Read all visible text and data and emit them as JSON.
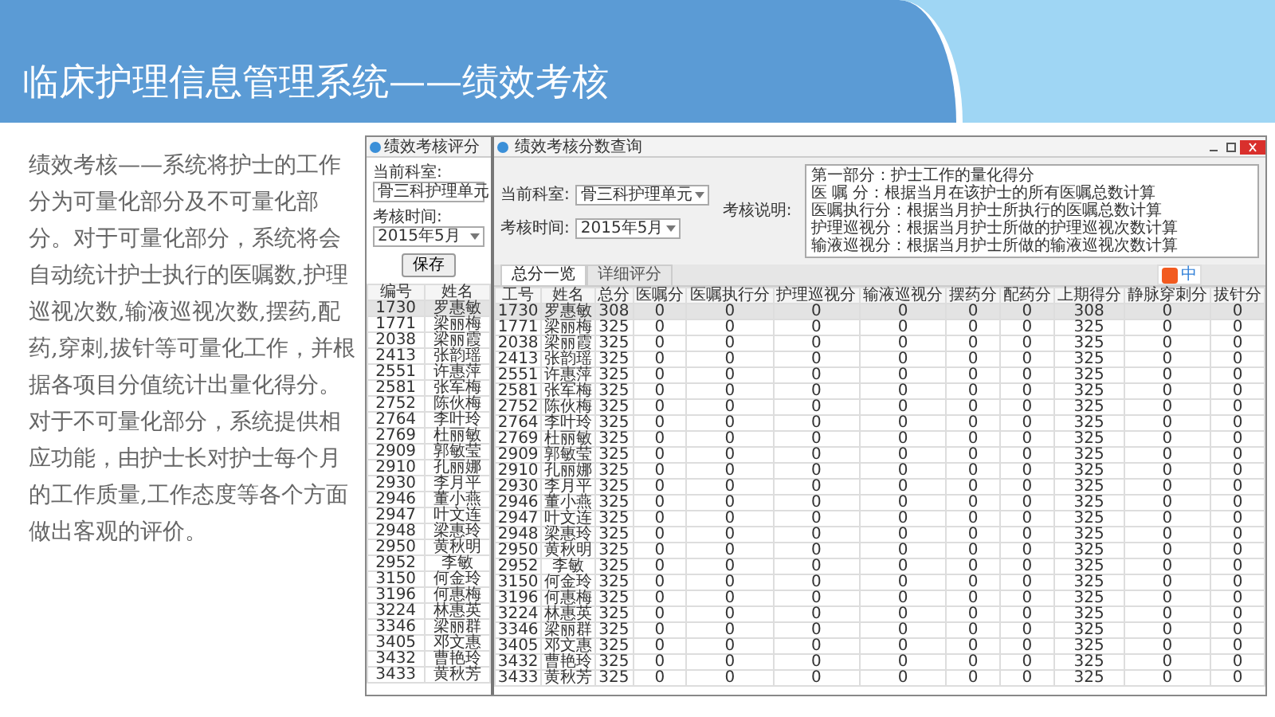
{
  "slide": {
    "title": "临床护理信息管理系统——绩效考核"
  },
  "description": "绩效考核——系统将护士的工作分为可量化部分及不可量化部分。对于可量化部分，系统将会自动统计护士执行的医嘱数,护理巡视次数,输液巡视次数,摆药,配药,穿刺,拔针等可量化工作，并根据各项目分值统计出量化得分。对于不可量化部分，系统提供相应功能，由护士长对护士每个月的工作质量,工作态度等各个方面做出客观的评价。",
  "score_window": {
    "title": "绩效考核评分",
    "fields": [
      {
        "label": "当前科室:",
        "value": "骨三科护理单元"
      },
      {
        "label": "考核时间:",
        "value": "2015年5月"
      }
    ],
    "save_button": "保存",
    "columns": [
      "编号",
      "姓名"
    ],
    "rows": [
      {
        "cells": [
          "1730",
          "罗惠敏"
        ],
        "selected": true
      },
      {
        "cells": [
          "1771",
          "梁丽梅"
        ],
        "selected": false
      },
      {
        "cells": [
          "2038",
          "梁丽霞"
        ],
        "selected": false
      },
      {
        "cells": [
          "2413",
          "张韵瑶"
        ],
        "selected": false
      },
      {
        "cells": [
          "2551",
          "许惠萍"
        ],
        "selected": false
      },
      {
        "cells": [
          "2581",
          "张军梅"
        ],
        "selected": false
      },
      {
        "cells": [
          "2752",
          "陈伙梅"
        ],
        "selected": false
      },
      {
        "cells": [
          "2764",
          "李叶玲"
        ],
        "selected": false
      },
      {
        "cells": [
          "2769",
          "杜丽敏"
        ],
        "selected": false
      },
      {
        "cells": [
          "2909",
          "郭敏莹"
        ],
        "selected": false
      },
      {
        "cells": [
          "2910",
          "孔丽娜"
        ],
        "selected": false
      },
      {
        "cells": [
          "2930",
          "李月平"
        ],
        "selected": false
      },
      {
        "cells": [
          "2946",
          "董小燕"
        ],
        "selected": false
      },
      {
        "cells": [
          "2947",
          "叶文连"
        ],
        "selected": false
      },
      {
        "cells": [
          "2948",
          "梁惠玲"
        ],
        "selected": false
      },
      {
        "cells": [
          "2950",
          "黄秋明"
        ],
        "selected": false
      },
      {
        "cells": [
          "2952",
          "李敏"
        ],
        "selected": false
      },
      {
        "cells": [
          "3150",
          "何金玲"
        ],
        "selected": false
      },
      {
        "cells": [
          "3196",
          "何惠梅"
        ],
        "selected": false
      },
      {
        "cells": [
          "3224",
          "林惠英"
        ],
        "selected": false
      },
      {
        "cells": [
          "3346",
          "梁丽群"
        ],
        "selected": false
      },
      {
        "cells": [
          "3405",
          "邓文惠"
        ],
        "selected": false
      },
      {
        "cells": [
          "3432",
          "曹艳玲"
        ],
        "selected": false
      },
      {
        "cells": [
          "3433",
          "黄秋芳"
        ],
        "selected": false
      }
    ]
  },
  "query_window": {
    "title": "绩效考核分数查询",
    "fields": [
      {
        "label": "当前科室:",
        "value": "骨三科护理单元"
      },
      {
        "label": "考核时间:",
        "value": "2015年5月"
      }
    ],
    "notes_label": "考核说明:",
    "notes": [
      "第一部分：护士工作的量化得分",
      "医 嘱 分：根据当月在该护士的所有医嘱总数计算",
      "医嘱执行分：根据当月护士所执行的医嘱总数计算",
      "护理巡视分：根据当月护士所做的护理巡视次数计算",
      "输液巡视分：根据当月护士所做的输液巡视次数计算"
    ],
    "tabs": [
      {
        "label": "总分一览",
        "selected": true
      },
      {
        "label": "详细评分",
        "selected": false
      }
    ],
    "columns": [
      "工号",
      "姓名",
      "总分",
      "医嘱分",
      "医嘱执行分",
      "护理巡视分",
      "输液巡视分",
      "摆药分",
      "配药分",
      "上期得分",
      "静脉穿刺分",
      "拔针分"
    ],
    "rows": [
      {
        "cells": [
          "1730",
          "罗惠敏",
          "308",
          "0",
          "0",
          "0",
          "0",
          "0",
          "0",
          "308",
          "0",
          "0"
        ],
        "selected": true
      },
      {
        "cells": [
          "1771",
          "梁丽梅",
          "325",
          "0",
          "0",
          "0",
          "0",
          "0",
          "0",
          "325",
          "0",
          "0"
        ],
        "selected": false
      },
      {
        "cells": [
          "2038",
          "梁丽霞",
          "325",
          "0",
          "0",
          "0",
          "0",
          "0",
          "0",
          "325",
          "0",
          "0"
        ],
        "selected": false
      },
      {
        "cells": [
          "2413",
          "张韵瑶",
          "325",
          "0",
          "0",
          "0",
          "0",
          "0",
          "0",
          "325",
          "0",
          "0"
        ],
        "selected": false
      },
      {
        "cells": [
          "2551",
          "许惠萍",
          "325",
          "0",
          "0",
          "0",
          "0",
          "0",
          "0",
          "325",
          "0",
          "0"
        ],
        "selected": false
      },
      {
        "cells": [
          "2581",
          "张军梅",
          "325",
          "0",
          "0",
          "0",
          "0",
          "0",
          "0",
          "325",
          "0",
          "0"
        ],
        "selected": false
      },
      {
        "cells": [
          "2752",
          "陈伙梅",
          "325",
          "0",
          "0",
          "0",
          "0",
          "0",
          "0",
          "325",
          "0",
          "0"
        ],
        "selected": false
      },
      {
        "cells": [
          "2764",
          "李叶玲",
          "325",
          "0",
          "0",
          "0",
          "0",
          "0",
          "0",
          "325",
          "0",
          "0"
        ],
        "selected": false
      },
      {
        "cells": [
          "2769",
          "杜丽敏",
          "325",
          "0",
          "0",
          "0",
          "0",
          "0",
          "0",
          "325",
          "0",
          "0"
        ],
        "selected": false
      },
      {
        "cells": [
          "2909",
          "郭敏莹",
          "325",
          "0",
          "0",
          "0",
          "0",
          "0",
          "0",
          "325",
          "0",
          "0"
        ],
        "selected": false
      },
      {
        "cells": [
          "2910",
          "孔丽娜",
          "325",
          "0",
          "0",
          "0",
          "0",
          "0",
          "0",
          "325",
          "0",
          "0"
        ],
        "selected": false
      },
      {
        "cells": [
          "2930",
          "李月平",
          "325",
          "0",
          "0",
          "0",
          "0",
          "0",
          "0",
          "325",
          "0",
          "0"
        ],
        "selected": false
      },
      {
        "cells": [
          "2946",
          "董小燕",
          "325",
          "0",
          "0",
          "0",
          "0",
          "0",
          "0",
          "325",
          "0",
          "0"
        ],
        "selected": false
      },
      {
        "cells": [
          "2947",
          "叶文连",
          "325",
          "0",
          "0",
          "0",
          "0",
          "0",
          "0",
          "325",
          "0",
          "0"
        ],
        "selected": false
      },
      {
        "cells": [
          "2948",
          "梁惠玲",
          "325",
          "0",
          "0",
          "0",
          "0",
          "0",
          "0",
          "325",
          "0",
          "0"
        ],
        "selected": false
      },
      {
        "cells": [
          "2950",
          "黄秋明",
          "325",
          "0",
          "0",
          "0",
          "0",
          "0",
          "0",
          "325",
          "0",
          "0"
        ],
        "selected": false
      },
      {
        "cells": [
          "2952",
          "李敏",
          "325",
          "0",
          "0",
          "0",
          "0",
          "0",
          "0",
          "325",
          "0",
          "0"
        ],
        "selected": false
      },
      {
        "cells": [
          "3150",
          "何金玲",
          "325",
          "0",
          "0",
          "0",
          "0",
          "0",
          "0",
          "325",
          "0",
          "0"
        ],
        "selected": false
      },
      {
        "cells": [
          "3196",
          "何惠梅",
          "325",
          "0",
          "0",
          "0",
          "0",
          "0",
          "0",
          "325",
          "0",
          "0"
        ],
        "selected": false
      },
      {
        "cells": [
          "3224",
          "林惠英",
          "325",
          "0",
          "0",
          "0",
          "0",
          "0",
          "0",
          "325",
          "0",
          "0"
        ],
        "selected": false
      },
      {
        "cells": [
          "3346",
          "梁丽群",
          "325",
          "0",
          "0",
          "0",
          "0",
          "0",
          "0",
          "325",
          "0",
          "0"
        ],
        "selected": false
      },
      {
        "cells": [
          "3405",
          "邓文惠",
          "325",
          "0",
          "0",
          "0",
          "0",
          "0",
          "0",
          "325",
          "0",
          "0"
        ],
        "selected": false
      },
      {
        "cells": [
          "3432",
          "曹艳玲",
          "325",
          "0",
          "0",
          "0",
          "0",
          "0",
          "0",
          "325",
          "0",
          "0"
        ],
        "selected": false
      },
      {
        "cells": [
          "3433",
          "黄秋芳",
          "325",
          "0",
          "0",
          "0",
          "0",
          "0",
          "0",
          "325",
          "0",
          "0"
        ],
        "selected": false
      }
    ]
  },
  "ime_toolbar": {
    "label": "中"
  }
}
